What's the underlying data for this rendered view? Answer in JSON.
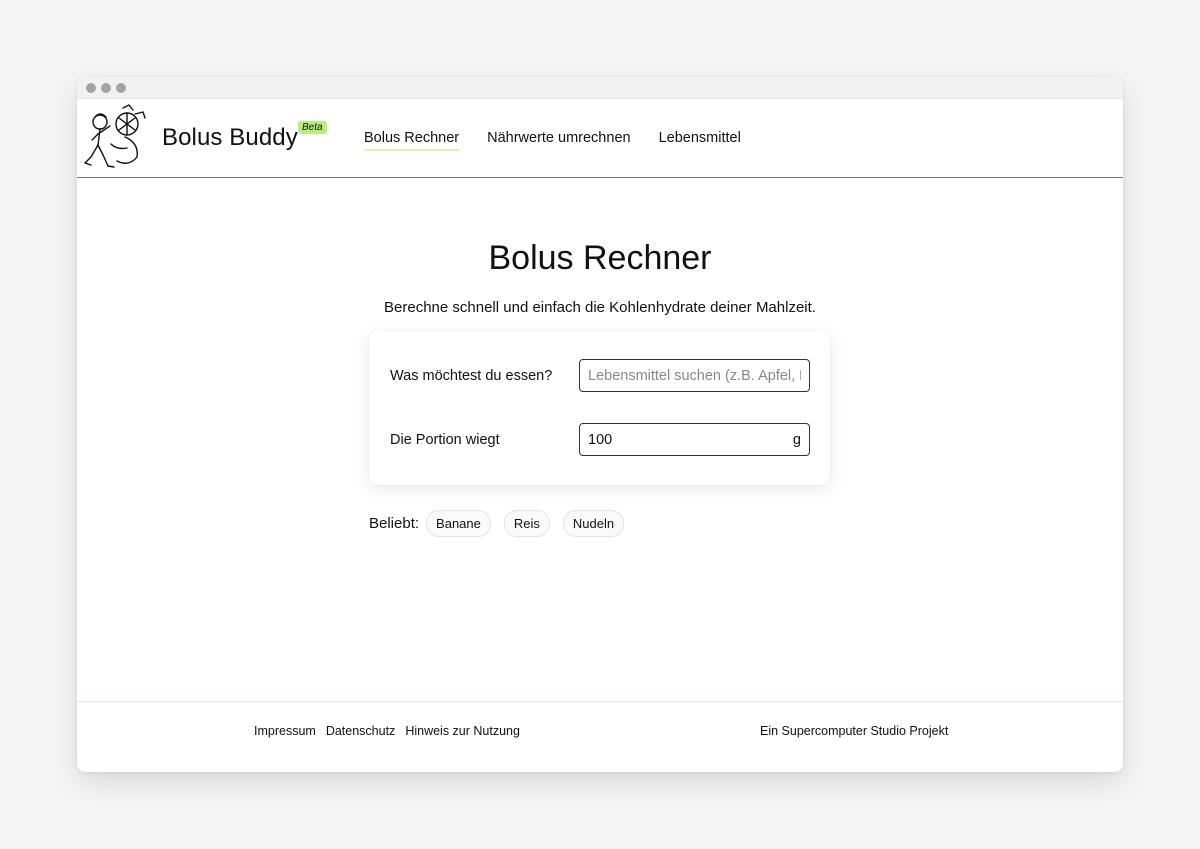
{
  "window": {
    "dots": [
      "red",
      "yellow",
      "green"
    ]
  },
  "header": {
    "brand": "Bolus Buddy",
    "badge": "Beta",
    "nav": [
      {
        "label": "Bolus Rechner",
        "active": true
      },
      {
        "label": "Nährwerte umrechnen",
        "active": false
      },
      {
        "label": "Lebensmittel",
        "active": false
      }
    ]
  },
  "main": {
    "title": "Bolus Rechner",
    "subtitle": "Berechne schnell und einfach die Kohlenhydrate deiner Mahlzeit.",
    "food": {
      "label": "Was möchtest du essen?",
      "placeholder": "Lebensmittel suchen (z.B. Apfel, Reis...)"
    },
    "portion": {
      "label": "Die Portion wiegt",
      "value": "100",
      "unit": "g"
    },
    "popular": {
      "label": "Beliebt:",
      "items": [
        "Banane",
        "Reis",
        "Nudeln"
      ]
    }
  },
  "footer": {
    "links": [
      "Impressum",
      "Datenschutz",
      "Hinweis zur Nutzung"
    ],
    "credit": "Ein Supercomputer Studio Projekt"
  },
  "colors": {
    "accent": "#b8ef7a",
    "nav_underline": "#d6f5b0",
    "footer_border": "#dcf3c2"
  }
}
